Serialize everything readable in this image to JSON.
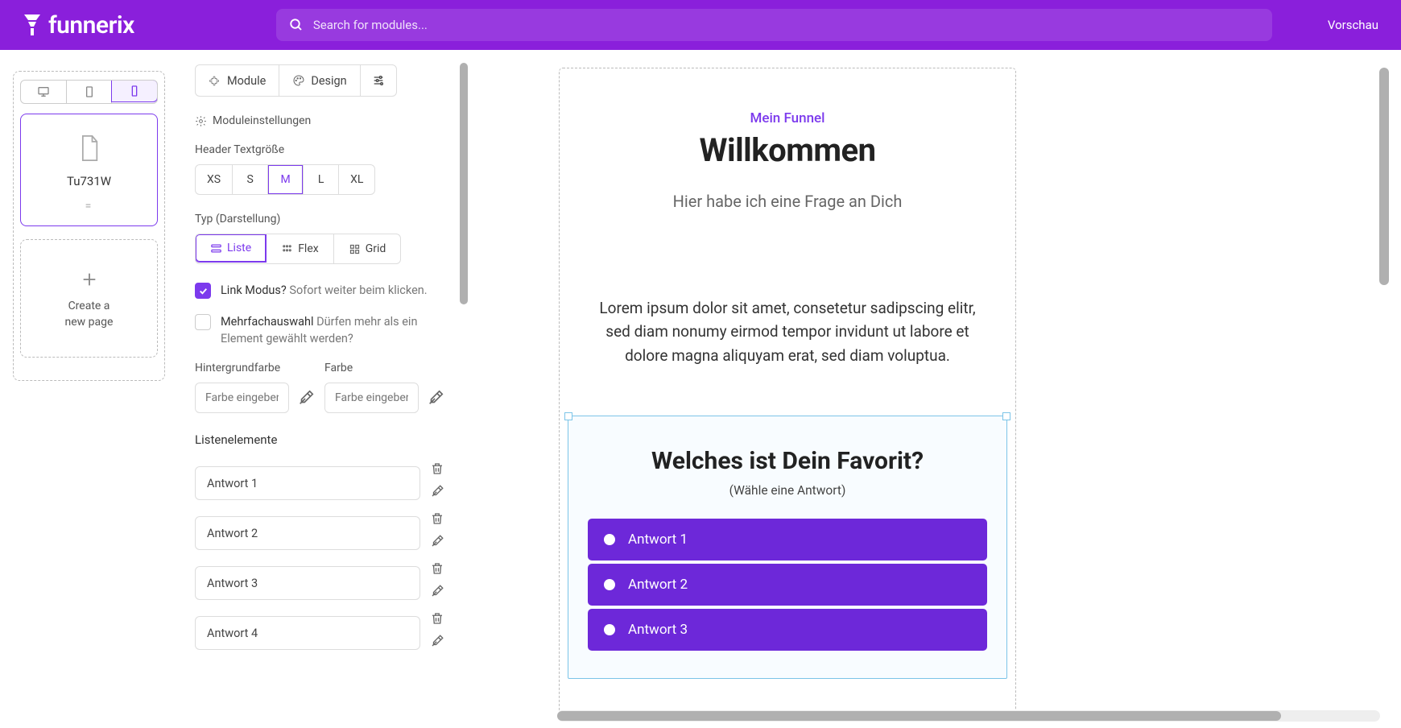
{
  "brand": "funnerix",
  "search": {
    "placeholder": "Search for modules..."
  },
  "header": {
    "vorschau": "Vorschau"
  },
  "sidebar": {
    "page_label": "Tu731W",
    "add_page": "Create a\nnew page"
  },
  "tabs": {
    "module": "Module",
    "design": "Design"
  },
  "settings": {
    "section_title": "Moduleinstellungen",
    "header_size_label": "Header Textgröße",
    "sizes": [
      "XS",
      "S",
      "M",
      "L",
      "XL"
    ],
    "size_active": "M",
    "typ_label": "Typ (Darstellung)",
    "typ_options": {
      "liste": "Liste",
      "flex": "Flex",
      "grid": "Grid"
    },
    "link_modus": {
      "title": "Link Modus?",
      "desc": "Sofort weiter beim klicken."
    },
    "mehrfach": {
      "title": "Mehrfachauswahl",
      "desc": "Dürfen mehr als ein Element gewählt werden?"
    },
    "bg_label": "Hintergrundfarbe",
    "fg_label": "Farbe",
    "color_placeholder": "Farbe eingeben",
    "list_title": "Listenelemente",
    "items": [
      "Antwort 1",
      "Antwort 2",
      "Antwort 3",
      "Antwort 4"
    ]
  },
  "preview": {
    "eyebrow": "Mein Funnel",
    "title": "Willkommen",
    "subtitle": "Hier habe ich eine Frage an Dich",
    "body": "Lorem ipsum dolor sit amet, consetetur sadipscing elitr, sed diam nonumy eirmod tempor invidunt ut labore et dolore magna aliquyam erat, sed diam voluptua.",
    "question": "Welches ist Dein Favorit?",
    "question_sub": "(Wähle eine Antwort)",
    "answers": [
      "Antwort 1",
      "Antwort 2",
      "Antwort 3"
    ]
  }
}
